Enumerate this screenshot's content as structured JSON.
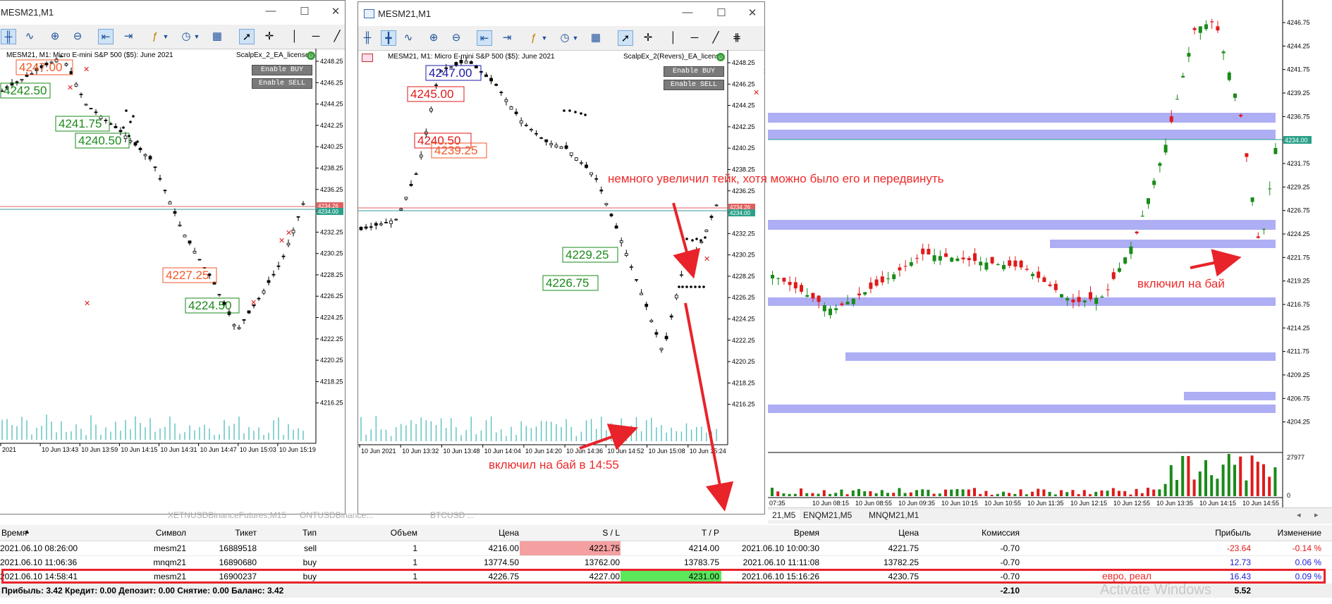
{
  "window_left": {
    "title": "MESM21,M1",
    "chart_info": "MESM21, M1:  Micro E-mini S&P 500 ($5): June 2021",
    "ea_name": "ScalpEx_2_EA_license",
    "buttons": [
      "Enable BUY",
      "Enable SELL"
    ],
    "price_ticks": [
      "4248.25",
      "4246.25",
      "4244.25",
      "4242.25",
      "4240.25",
      "4238.25",
      "4236.25",
      "4234.25",
      "4232.25",
      "4230.25",
      "4228.25",
      "4226.25",
      "4224.25",
      "4222.25",
      "4220.25",
      "4218.25",
      "4216.25"
    ],
    "current_price": "4234.00",
    "level_label": "4234.26",
    "time_ticks": [
      "2021",
      "10 Jun 13:43",
      "10 Jun 13:59",
      "10 Jun 14:15",
      "10 Jun 14:31",
      "10 Jun 14:47",
      "10 Jun 15:03",
      "10 Jun 15:19"
    ],
    "labels": [
      {
        "text": "4247.00",
        "color": "#f05a28"
      },
      {
        "text": "4242.50",
        "color": "#1a8a1a"
      },
      {
        "text": "4241.75",
        "color": "#1a8a1a"
      },
      {
        "text": "4240.50",
        "color": "#1a8a1a"
      },
      {
        "text": "4227.25",
        "color": "#f05a28"
      },
      {
        "text": "4224.50",
        "color": "#1a8a1a"
      }
    ]
  },
  "window_mid": {
    "title": "MESM21,M1",
    "chart_info": "MESM21, M1:  Micro E-mini S&P 500 ($5): June 2021",
    "ea_name": "ScalpEx_2(Revers)_EA_license",
    "buttons": [
      "Enable BUY",
      "Enable SELL"
    ],
    "price_ticks": [
      "4248.25",
      "4246.25",
      "4244.25",
      "4242.25",
      "4240.25",
      "4238.25",
      "4236.25",
      "4234.25",
      "4232.25",
      "4230.25",
      "4228.25",
      "4226.25",
      "4224.25",
      "4222.25",
      "4220.25",
      "4218.25",
      "4216.25"
    ],
    "current_price": "4234.00",
    "level_label": "4234.26",
    "time_ticks": [
      "10 Jun 2021",
      "10 Jun 13:32",
      "10 Jun 13:48",
      "10 Jun 14:04",
      "10 Jun 14:20",
      "10 Jun 14:36",
      "10 Jun 14:52",
      "10 Jun 15:08",
      "10 Jun 15:24"
    ],
    "labels": [
      {
        "text": "4247.00",
        "color": "#1a1aa8"
      },
      {
        "text": "4245.00",
        "color": "#e01a1a"
      },
      {
        "text": "4240.50",
        "color": "#e01a1a"
      },
      {
        "text": "4239.25",
        "color": "#f05a28"
      },
      {
        "text": "4229.25",
        "color": "#1a8a1a"
      },
      {
        "text": "4226.75",
        "color": "#1a8a1a"
      }
    ]
  },
  "right_chart": {
    "price_ticks": [
      "4246.75",
      "4244.25",
      "4241.75",
      "4239.25",
      "4236.75",
      "4234.00",
      "4231.75",
      "4229.25",
      "4226.75",
      "4224.25",
      "4221.75",
      "4219.25",
      "4216.75",
      "4214.25",
      "4211.75",
      "4209.25",
      "4206.75",
      "4204.25"
    ],
    "volume_ticks": [
      "27977",
      "0"
    ],
    "time_ticks": [
      "07:35",
      "10 Jun 08:15",
      "10 Jun 08:55",
      "10 Jun 09:35",
      "10 Jun 10:15",
      "10 Jun 10:55",
      "10 Jun 11:35",
      "10 Jun 12:15",
      "10 Jun 12:55",
      "10 Jun 13:35",
      "10 Jun 14:15",
      "10 Jun 14:55"
    ]
  },
  "tabs": [
    "21,M5",
    "ENQM21,M5",
    "MNQM21,M1"
  ],
  "background_tabs": [
    "XETNUSDBinanceFutures,M15",
    "ONTUSDBinance...",
    "BTCUSD ..."
  ],
  "annotations": {
    "take": "немного увеличил тейк, хотя можно было его и передвинуть",
    "buy_time": "включил на бай в 14:55",
    "buy": "включил на бай",
    "euro": "евро, реал"
  },
  "table": {
    "headers": [
      "Время",
      "Символ",
      "Тикет",
      "Тип",
      "Объем",
      "Цена",
      "S / L",
      "T / P",
      "Время",
      "Цена",
      "Комиссия",
      "Прибыль",
      "Изменение"
    ],
    "rows": [
      {
        "time": "2021.06.10 08:26:00",
        "symbol": "mesm21",
        "ticket": "16889518",
        "type": "sell",
        "volume": "1",
        "price": "4216.00",
        "sl": "4221.75",
        "tp": "4214.00",
        "close_time": "2021.06.10 10:00:30",
        "close_price": "4221.75",
        "commission": "-0.70",
        "profit": "-23.64",
        "change": "-0.14 %"
      },
      {
        "time": "2021.06.10 11:06:36",
        "symbol": "mnqm21",
        "ticket": "16890680",
        "type": "buy",
        "volume": "1",
        "price": "13774.50",
        "sl": "13762.00",
        "tp": "13783.75",
        "close_time": "2021.06.10 11:11:08",
        "close_price": "13782.25",
        "commission": "-0.70",
        "profit": "12.73",
        "change": "0.06 %"
      },
      {
        "time": "2021.06.10 14:58:41",
        "symbol": "mesm21",
        "ticket": "16900237",
        "type": "buy",
        "volume": "1",
        "price": "4226.75",
        "sl": "4227.00",
        "tp": "4231.00",
        "close_time": "2021.06.10 15:16:26",
        "close_price": "4230.75",
        "commission": "-0.70",
        "profit": "16.43",
        "change": "0.09 %"
      }
    ]
  },
  "footer": {
    "summary": "Прибыль: 3.42  Кредит: 0.00  Депозит: 0.00  Снятие: 0.00  Баланс: 3.42",
    "commission_total": "-2.10",
    "profit_total": "5.52"
  },
  "watermark": "Activate Windows",
  "colors": {
    "bull": "#1a8a1a",
    "bear": "#e01a1a",
    "zone": "#8c8cf0",
    "accent": "#e8232a",
    "tp_fill": "#5be85b",
    "sl_fill": "#f4a0a0"
  }
}
